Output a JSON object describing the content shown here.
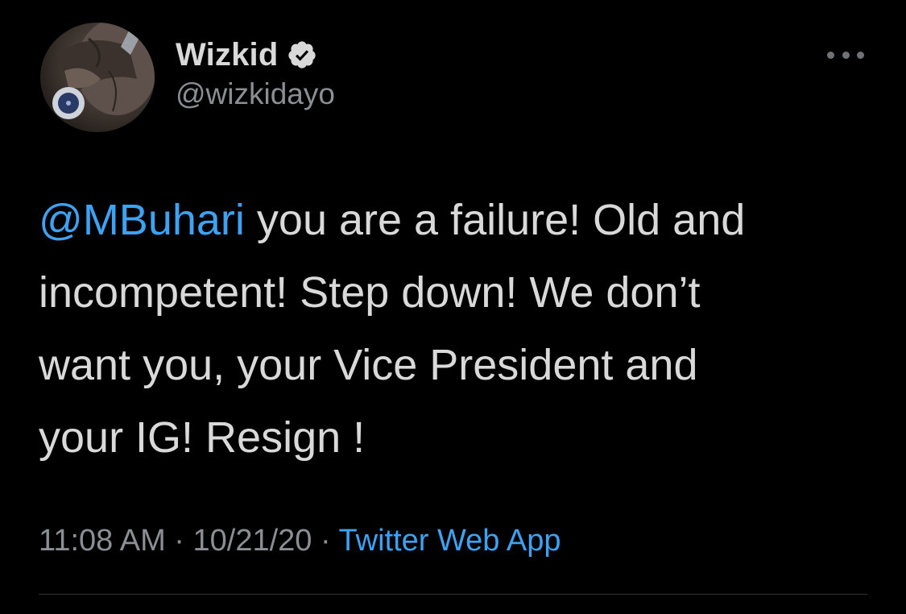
{
  "author": {
    "display_name": "Wizkid",
    "handle": "@wizkidayo",
    "verified": true,
    "avatar_icon": "profile-photo"
  },
  "more_icon": "more-horizontal-icon",
  "tweet": {
    "mention": "@MBuhari",
    "line1_rest": " you are a failure! Old and",
    "line2": "incompetent! Step down! We don’t",
    "line3": "want you, your Vice President and",
    "line4": "your IG! Resign !"
  },
  "meta": {
    "time": "11:08 AM",
    "sep1": " · ",
    "date": "10/21/20",
    "sep2": " · ",
    "source": "Twitter Web App"
  },
  "colors": {
    "background": "#000000",
    "text": "#d9d9d9",
    "secondary": "#8b8f94",
    "link": "#3ea2f2",
    "divider": "#2f3336"
  }
}
